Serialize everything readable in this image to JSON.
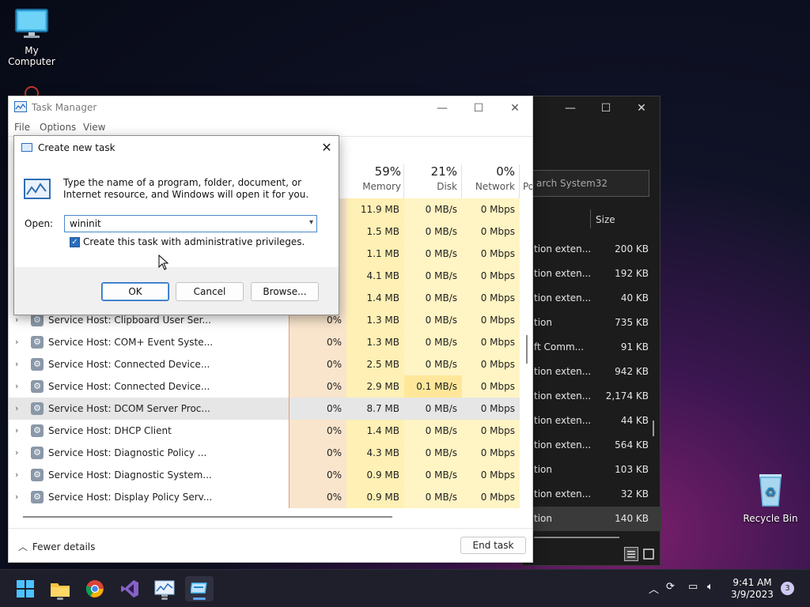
{
  "desktop": {
    "icons": [
      {
        "label": "My Computer"
      },
      {
        "label": "Recycle Bin"
      }
    ]
  },
  "explorer": {
    "search_placeholder": "arch System32",
    "column_size": "Size",
    "rows": [
      {
        "name": "tion exten...",
        "size": "200 KB"
      },
      {
        "name": "tion exten...",
        "size": "192 KB"
      },
      {
        "name": "tion exten...",
        "size": "40 KB"
      },
      {
        "name": "tion",
        "size": "735 KB"
      },
      {
        "name": "ft Comm...",
        "size": "91 KB"
      },
      {
        "name": "tion exten...",
        "size": "942 KB"
      },
      {
        "name": "tion exten...",
        "size": "2,174 KB"
      },
      {
        "name": "tion exten...",
        "size": "44 KB"
      },
      {
        "name": "tion exten...",
        "size": "564 KB"
      },
      {
        "name": "tion",
        "size": "103 KB"
      },
      {
        "name": "tion exten...",
        "size": "32 KB"
      },
      {
        "name": "tion",
        "size": "140 KB"
      }
    ]
  },
  "task_manager": {
    "title": "Task Manager",
    "menu": [
      "File",
      "Options",
      "View"
    ],
    "columns": {
      "memory": {
        "pct": "59%",
        "name": "Memory"
      },
      "disk": {
        "pct": "21%",
        "name": "Disk"
      },
      "network": {
        "pct": "0%",
        "name": "Network"
      },
      "power": {
        "name": "Po"
      }
    },
    "hidden_rows": [
      {
        "mem": "11.9 MB",
        "disk": "0 MB/s",
        "net": "0 Mbps"
      },
      {
        "mem": "1.5 MB",
        "disk": "0 MB/s",
        "net": "0 Mbps"
      },
      {
        "mem": "1.1 MB",
        "disk": "0 MB/s",
        "net": "0 Mbps"
      },
      {
        "mem": "4.1 MB",
        "disk": "0 MB/s",
        "net": "0 Mbps"
      },
      {
        "mem": "1.4 MB",
        "disk": "0 MB/s",
        "net": "0 Mbps"
      }
    ],
    "rows": [
      {
        "name": "Service Host: Clipboard User Ser...",
        "cpu": "0%",
        "mem": "1.3 MB",
        "disk": "0 MB/s",
        "net": "0 Mbps"
      },
      {
        "name": "Service Host: COM+ Event Syste...",
        "cpu": "0%",
        "mem": "1.3 MB",
        "disk": "0 MB/s",
        "net": "0 Mbps"
      },
      {
        "name": "Service Host: Connected Device...",
        "cpu": "0%",
        "mem": "2.5 MB",
        "disk": "0 MB/s",
        "net": "0 Mbps"
      },
      {
        "name": "Service Host: Connected Device...",
        "cpu": "0%",
        "mem": "2.9 MB",
        "disk": "0.1 MB/s",
        "net": "0 Mbps"
      },
      {
        "name": "Service Host: DCOM Server Proc...",
        "cpu": "0%",
        "mem": "8.7 MB",
        "disk": "0 MB/s",
        "net": "0 Mbps"
      },
      {
        "name": "Service Host: DHCP Client",
        "cpu": "0%",
        "mem": "1.4 MB",
        "disk": "0 MB/s",
        "net": "0 Mbps"
      },
      {
        "name": "Service Host: Diagnostic Policy ...",
        "cpu": "0%",
        "mem": "4.3 MB",
        "disk": "0 MB/s",
        "net": "0 Mbps"
      },
      {
        "name": "Service Host: Diagnostic System...",
        "cpu": "0%",
        "mem": "0.9 MB",
        "disk": "0 MB/s",
        "net": "0 Mbps"
      },
      {
        "name": "Service Host: Display Policy Serv...",
        "cpu": "0%",
        "mem": "0.9 MB",
        "disk": "0 MB/s",
        "net": "0 Mbps"
      }
    ],
    "fewer_details": "Fewer details",
    "end_task": "End task"
  },
  "dialog": {
    "title": "Create new task",
    "description": "Type the name of a program, folder, document, or Internet resource, and Windows will open it for you.",
    "open_label": "Open:",
    "open_value": "wininit",
    "admin_checkbox_label": "Create this task with administrative privileges.",
    "admin_checked": true,
    "ok": "OK",
    "cancel": "Cancel",
    "browse": "Browse..."
  },
  "taskbar": {
    "apps": [
      "start-icon",
      "file-explorer-icon",
      "chrome-icon",
      "visual-studio-icon",
      "performance-monitor-icon",
      "task-manager-icon"
    ],
    "time": "9:41 AM",
    "date": "3/9/2023",
    "notifications": "3"
  }
}
